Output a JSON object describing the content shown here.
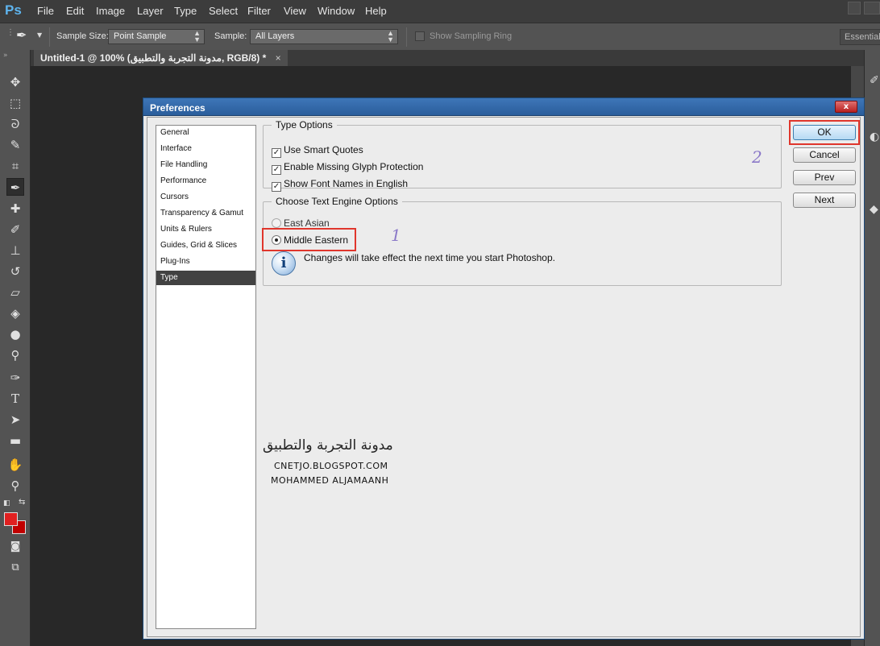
{
  "app": {
    "logo": "Ps"
  },
  "menubar": {
    "items": [
      "File",
      "Edit",
      "Image",
      "Layer",
      "Type",
      "Select",
      "Filter",
      "View",
      "Window",
      "Help"
    ]
  },
  "options_bar": {
    "sample_size_label": "Sample Size:",
    "sample_size_value": "Point Sample",
    "sample_label": "Sample:",
    "sample_value": "All Layers",
    "show_ring_label": "Show Sampling Ring",
    "show_ring_checked": false,
    "workspace": "Essentials"
  },
  "toolbar": {
    "tools": [
      "move-icon",
      "marquee-icon",
      "lasso-icon",
      "quick-selection-icon",
      "crop-icon",
      "eyedropper-icon",
      "healing-brush-icon",
      "brush-icon",
      "clone-stamp-icon",
      "history-brush-icon",
      "eraser-icon",
      "paint-bucket-icon",
      "blur-icon",
      "dodge-icon",
      "pen-icon",
      "type-icon",
      "path-selection-icon",
      "rectangle-icon",
      "hand-icon",
      "zoom-icon"
    ],
    "active_tool": "eyedropper-icon",
    "foreground_color": "#e02020",
    "background_color": "#c00000"
  },
  "document_tab": {
    "title": "Untitled-1 @ 100% (مدونة التجربة والتطبيق, RGB/8) *",
    "close": "×"
  },
  "dialog": {
    "title": "Preferences",
    "close": "x",
    "categories": [
      "General",
      "Interface",
      "File Handling",
      "Performance",
      "Cursors",
      "Transparency & Gamut",
      "Units & Rulers",
      "Guides, Grid & Slices",
      "Plug-Ins",
      "Type"
    ],
    "selected_category": "Type",
    "type_options": {
      "legend": "Type Options",
      "options": [
        {
          "label": "Use Smart Quotes",
          "checked": true
        },
        {
          "label": "Enable Missing Glyph Protection",
          "checked": true
        },
        {
          "label": "Show Font Names in English",
          "checked": true
        }
      ]
    },
    "text_engine": {
      "legend": "Choose Text Engine Options",
      "east_asian": "East Asian",
      "middle_eastern": "Middle Eastern",
      "selected": "Middle Eastern",
      "info": "Changes will take effect the next time you start Photoshop."
    },
    "buttons": {
      "ok": "OK",
      "cancel": "Cancel",
      "prev": "Prev",
      "next": "Next"
    }
  },
  "annotations": {
    "step1": "1",
    "step2": "2",
    "highlight_color": "#e0362c"
  },
  "watermark": {
    "arabic": "مدونة التجربة والتطبيق",
    "url": "CNETJO.BLOGSPOT.COM",
    "author": "MOHAMMED ALJAMAANH"
  }
}
